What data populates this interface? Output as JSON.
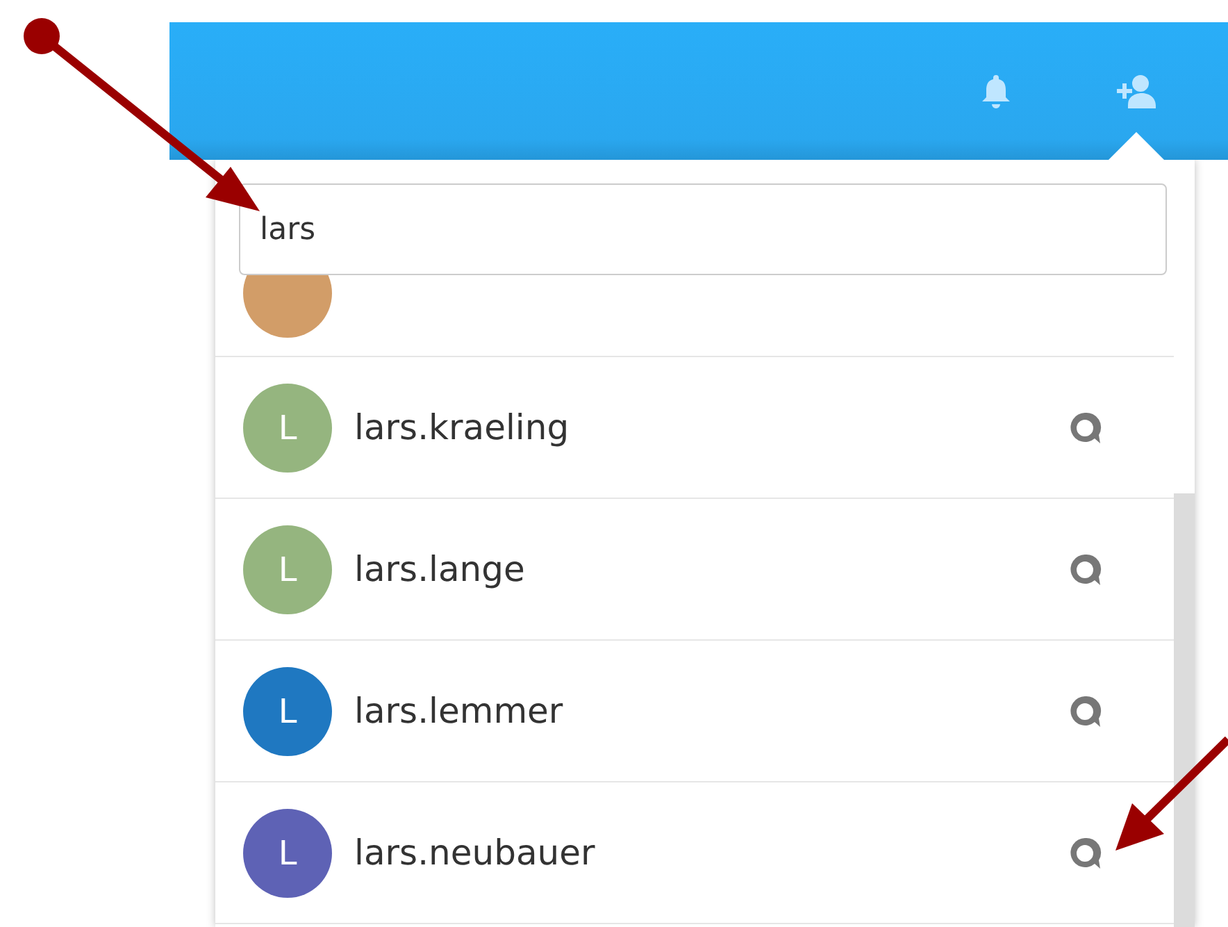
{
  "search": {
    "value": "lars"
  },
  "contacts": [
    {
      "kind": "partial",
      "color": "#d29d68"
    },
    {
      "kind": "full",
      "initial": "L",
      "name": "lars.kraeling",
      "color": "#95b57f"
    },
    {
      "kind": "full",
      "initial": "L",
      "name": "lars.lange",
      "color": "#95b57f"
    },
    {
      "kind": "full",
      "initial": "L",
      "name": "lars.lemmer",
      "color": "#1f78c1"
    },
    {
      "kind": "full",
      "initial": "L",
      "name": "lars.neubauer",
      "color": "#5e62b5"
    }
  ]
}
